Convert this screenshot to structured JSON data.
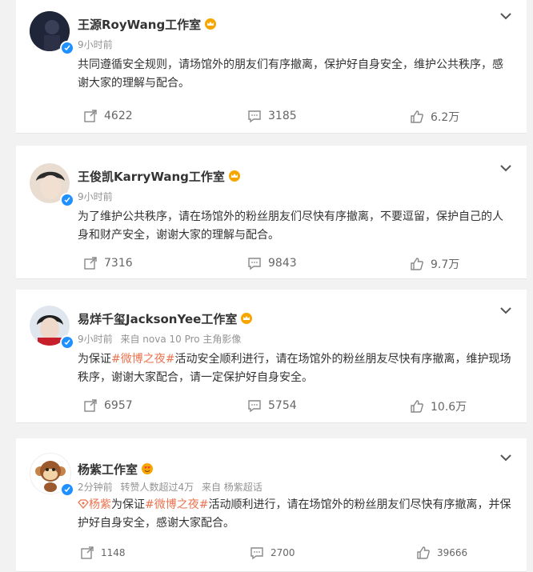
{
  "posts": [
    {
      "name": "王源RoyWang工作室",
      "time": "9小时前",
      "text": "共同遵循安全规则，请场馆外的朋友们有序撤离，保护好自身安全，维护公共秩序，感谢大家的理解与配合。",
      "reposts": "4622",
      "comments": "3185",
      "likes": "6.2万"
    },
    {
      "name": "王俊凯KarryWang工作室",
      "time": "9小时前",
      "text": "为了维护公共秩序，请在场馆外的粉丝朋友们尽快有序撤离，不要逗留，保护自己的人身和财产安全，谢谢大家的理解与配合。",
      "reposts": "7316",
      "comments": "9843",
      "likes": "9.7万"
    },
    {
      "name": "易烊千玺JacksonYee工作室",
      "time": "9小时前",
      "source": "来自 nova 10 Pro 主角影像",
      "text_pre": "为保证",
      "hashtag": "#微博之夜#",
      "text_post": "活动安全顺利进行，请在场馆外的粉丝朋友尽快有序撤离，维护现场秩序，谢谢大家配合，请一定保护好自身安全。",
      "reposts": "6957",
      "comments": "5754",
      "likes": "10.6万"
    },
    {
      "name": "杨紫工作室",
      "time": "2分钟前",
      "extra": "转赞人数超过4万",
      "source": "来自 杨紫超话",
      "mention": "杨紫",
      "text_pre": "为保证",
      "hashtag": "#微博之夜#",
      "text_post": "活动顺利进行，请在场馆外的粉丝朋友们尽快有序撤离，并保护好自身安全，感谢大家配合。",
      "reposts": "1148",
      "comments": "2700",
      "likes": "39666"
    }
  ],
  "colors": {
    "hashtag": "#eb7350",
    "verified": "#1e90ff",
    "crown": "#f7a600"
  }
}
